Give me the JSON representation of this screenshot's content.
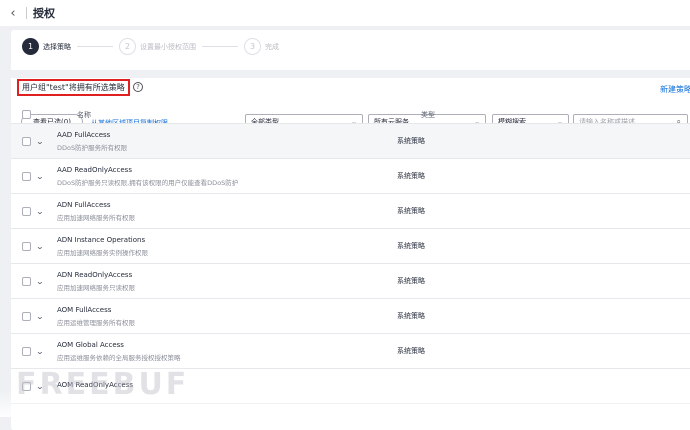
{
  "header": {
    "back_icon": "chevron-left-icon",
    "title": "授权"
  },
  "steps": [
    {
      "num": "1",
      "label": "选择策略",
      "state": "active"
    },
    {
      "num": "2",
      "label": "设置最小授权范围",
      "state": "inactive"
    },
    {
      "num": "3",
      "label": "完成",
      "state": "inactive"
    }
  ],
  "notice": {
    "text": "用户组\"test\"将拥有所选策略",
    "help_icon": "?"
  },
  "new_policy_link": "新建策略",
  "toolbar": {
    "view_selected": "查看已选(0)",
    "copy_link": "从其他区域项目复制权限",
    "type_filter": "全部类型",
    "service_filter": "所有云服务",
    "search_mode": "模糊搜索",
    "search_placeholder": "请输入名称或描述"
  },
  "table": {
    "columns": [
      "名称",
      "类型"
    ],
    "rows": [
      {
        "name": "AAD FullAccess",
        "desc": "DDoS防护服务所有权限",
        "type": "系统策略"
      },
      {
        "name": "AAD ReadOnlyAccess",
        "desc": "DDoS防护服务只读权限,拥有该权限的用户仅能查看DDoS防护",
        "type": "系统策略"
      },
      {
        "name": "ADN FullAccess",
        "desc": "应用加速网络服务所有权限",
        "type": "系统策略"
      },
      {
        "name": "ADN Instance Operations",
        "desc": "应用加速网络服务实例操作权限",
        "type": "系统策略"
      },
      {
        "name": "ADN ReadOnlyAccess",
        "desc": "应用加速网络服务只读权限",
        "type": "系统策略"
      },
      {
        "name": "AOM FullAccess",
        "desc": "应用运维管理服务所有权限",
        "type": "系统策略"
      },
      {
        "name": "AOM Global Access",
        "desc": "应用运维服务依赖的全局服务授权授权策略",
        "type": "系统策略"
      },
      {
        "name": "AOM ReadOnlyAccess",
        "desc": "",
        "type": ""
      }
    ]
  },
  "watermark": "FREEBUF"
}
